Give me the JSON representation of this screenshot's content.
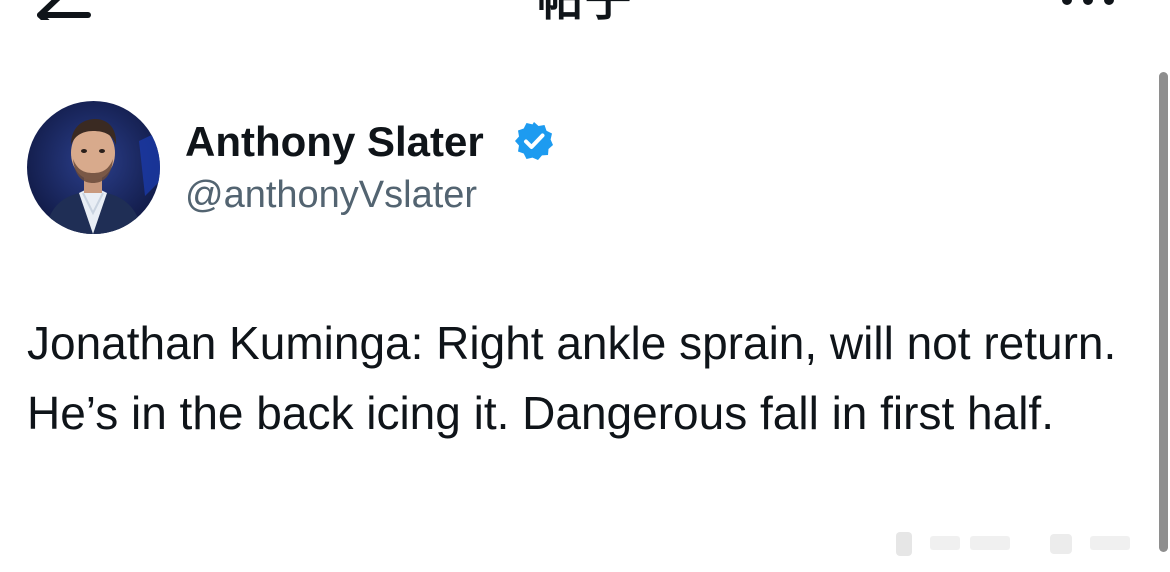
{
  "header": {
    "title": "帖子",
    "back_icon": "arrow-left-icon",
    "more_icon": "more-horizontal-icon"
  },
  "author": {
    "name": "Anthony Slater",
    "handle": "@anthonyVslater",
    "verified": true,
    "verified_color": "#1d9bf0",
    "avatar_icon": "avatar-photo"
  },
  "tweet": {
    "text": "Jonathan Kuminga: Right ankle sprain, will not return. He’s in the back icing it. Dangerous fall in first half."
  },
  "colors": {
    "text_primary": "#0f1419",
    "text_secondary": "#536471",
    "verified": "#1d9bf0"
  }
}
